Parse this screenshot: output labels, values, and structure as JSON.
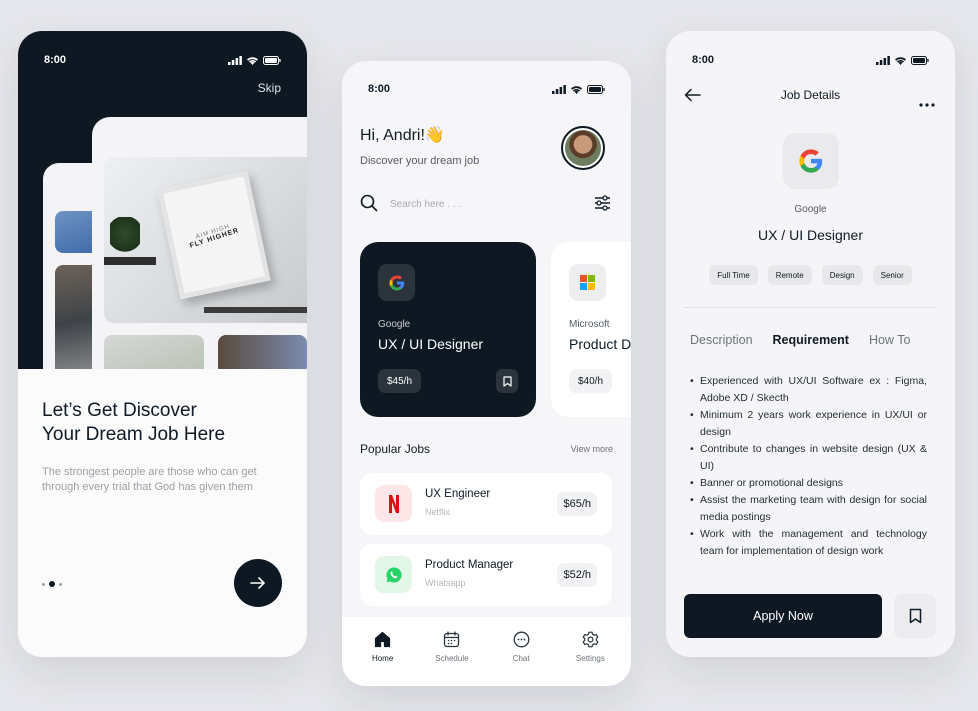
{
  "screen1": {
    "time": "8:00",
    "skip": "Skip",
    "frame_text": "FLY HIGHER",
    "frame_subtext": "AIM HIGH",
    "headline_line1": "Let’s Get Discover",
    "headline_line2": "Your Dream Job Here",
    "description": "The strongest people are those who can get through every trial that God has given them",
    "page_indicator": {
      "current": 2,
      "total": 3
    }
  },
  "screen2": {
    "time": "8:00",
    "greeting": "Hi, Andri!👋",
    "subtitle": "Discover your dream job",
    "search_placeholder": "Search here . . .",
    "featured_jobs": [
      {
        "company": "Google",
        "title": "UX / UI Designer",
        "rate": "$45/h"
      },
      {
        "company": "Microsoft",
        "title": "Product Designer",
        "rate": "$40/h"
      }
    ],
    "popular_title": "Popular Jobs",
    "view_more": "View more",
    "popular_jobs": [
      {
        "title": "UX Engineer",
        "company": "Netflix",
        "rate": "$65/h",
        "logo_letter": "N",
        "logo_color": "#e50914",
        "logo_bg": "#fde6e7"
      },
      {
        "title": "Product Manager",
        "company": "Whatsapp",
        "rate": "$52/h",
        "logo_bg": "#e3f7e8",
        "logo_color": "#25d366"
      }
    ],
    "tabs": [
      {
        "label": "Home",
        "icon": "home-icon"
      },
      {
        "label": "Schedule",
        "icon": "calendar-icon"
      },
      {
        "label": "Chat",
        "icon": "chat-icon"
      },
      {
        "label": "Settings",
        "icon": "gear-icon"
      }
    ]
  },
  "screen3": {
    "time": "8:00",
    "title": "Job Details",
    "company": "Google",
    "job_title": "UX / UI Designer",
    "tags": [
      "Full Time",
      "Remote",
      "Design",
      "Senior"
    ],
    "detail_tabs": [
      "Description",
      "Requirement",
      "How To"
    ],
    "active_tab": "Requirement",
    "requirements": [
      "Experienced with UX/UI Software ex : Figma, Adobe XD / Skecth",
      "Minimum 2 years work experience in UX/UI or design",
      "Contribute to changes in website design (UX & UI)",
      "Banner or promotional designs",
      "Assist the marketing team with design for social media postings",
      "Work with the management and technology team for implementation of design work"
    ],
    "apply_label": "Apply Now"
  },
  "colors": {
    "primary_dark": "#0e1823",
    "background": "#e6e7ec",
    "netflix_red": "#e50914",
    "whatsapp_green": "#25d366",
    "microsoft_red": "#f25022",
    "microsoft_green": "#7fba00",
    "microsoft_blue": "#00a4ef",
    "microsoft_yellow": "#ffb900"
  }
}
